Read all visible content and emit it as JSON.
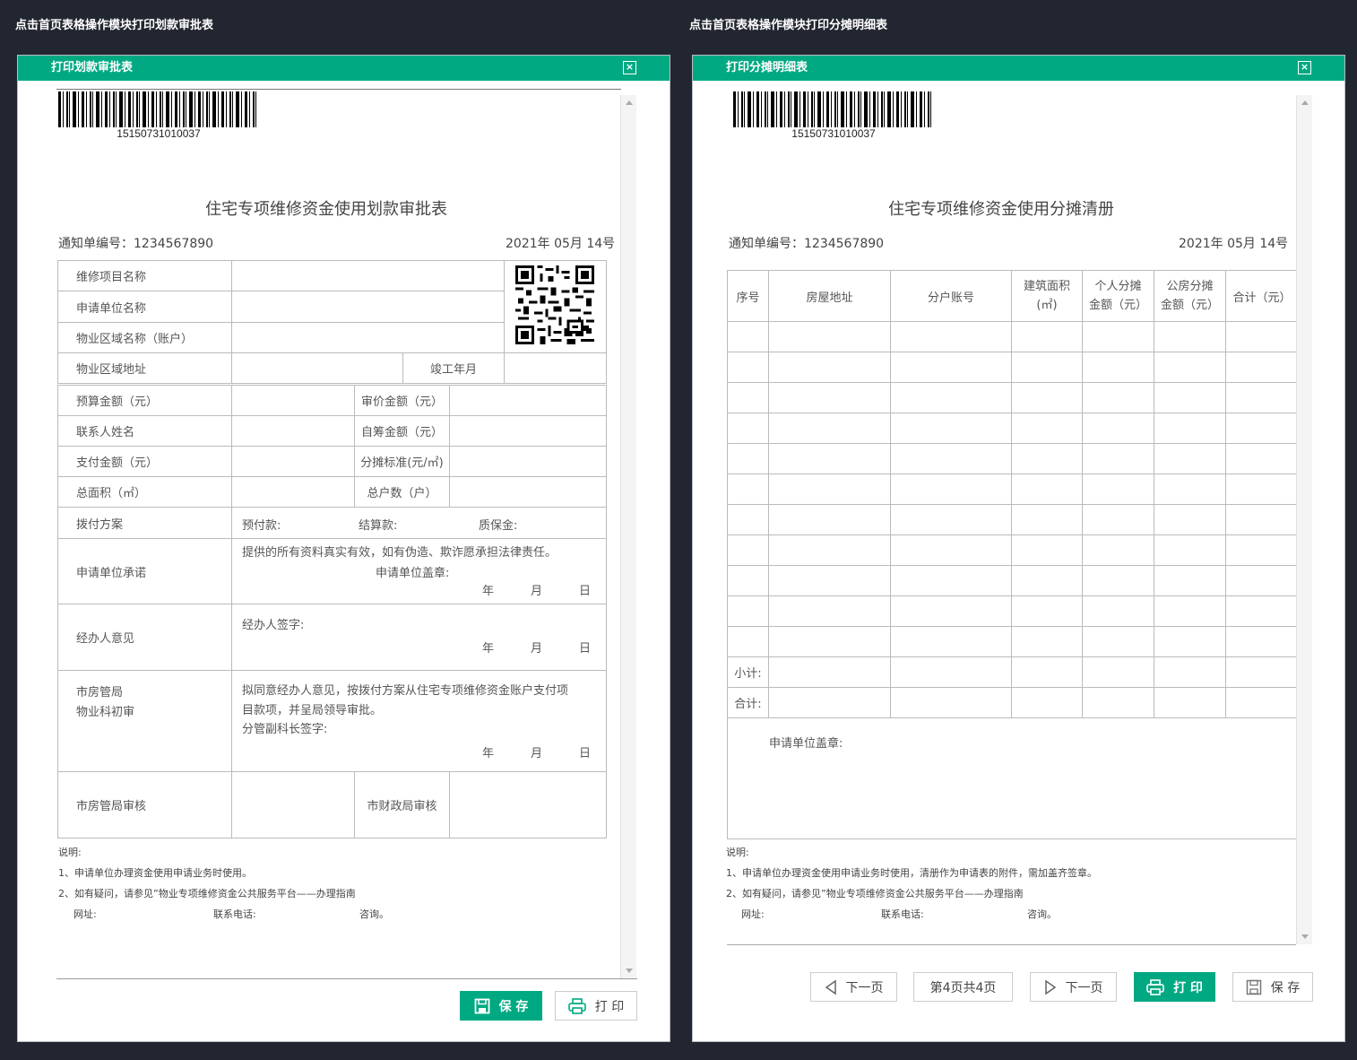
{
  "captions": {
    "left": "点击首页表格操作模块打印划款审批表",
    "right": "点击首页表格操作模块打印分摊明细表"
  },
  "left_dialog": {
    "title": "打印划款审批表",
    "barcode": "15150731010037",
    "form_title": "住宅专项维修资金使用划款审批表",
    "notice_no": "通知单编号：1234567890",
    "date": "2021年 05月 14号",
    "rows": {
      "project_name": "维修项目名称",
      "applicant_name": "申请单位名称",
      "area_name": "物业区域名称（账户）",
      "area_address": "物业区域地址",
      "completion": "竣工年月",
      "budget": "预算金额（元）",
      "audit_amount": "审价金额（元）",
      "contact": "联系人姓名",
      "self_raised": "自筹金额（元）",
      "pay_amount": "支付金额（元）",
      "share_std": "分摊标准(元/㎡)",
      "total_area": "总面积（㎡）",
      "households": "总户数（户）",
      "allocation": "拨付方案",
      "prepay": "预付款:",
      "settle": "结算款:",
      "warranty": "质保金:",
      "promise": "申请单位承诺",
      "promise_text": "提供的所有资料真实有效，如有伪造、欺诈愿承担法律责任。",
      "promise_seal": "申请单位盖章:",
      "handler_opinion": "经办人意见",
      "handler_sign": "经办人签字:",
      "bureau_l1": "市房管局",
      "bureau_l2": "物业科初审",
      "bureau_text1": "拟同意经办人意见，按拨付方案从住宅专项维修资金账户支付项",
      "bureau_text2": "目款项，并呈局领导审批。",
      "bureau_sign": "分管副科长签字:",
      "review": "市房管局审核",
      "finance_review": "市财政局审核",
      "year": "年",
      "month": "月",
      "day": "日"
    },
    "notes": [
      "说明:",
      "1、申请单位办理资金使用申请业务时使用。",
      "2、如有疑问，请参见”物业专项维修资金公共服务平台——办理指南",
      "网址:",
      "联系电话:",
      "咨询。"
    ],
    "buttons": {
      "save": "保 存",
      "print": "打 印"
    }
  },
  "right_dialog": {
    "title": "打印分摊明细表",
    "barcode": "15150731010037",
    "form_title": "住宅专项维修资金使用分摊清册",
    "notice_no": "通知单编号：1234567890",
    "date": "2021年 05月 14号",
    "columns": [
      "序号",
      "房屋地址",
      "分户账号",
      "建筑面积",
      "(㎡)",
      "个人分摊",
      "金额（元）",
      "公房分摊",
      "金额（元）",
      "合计（元）"
    ],
    "subtotal": "小计:",
    "total": "合计:",
    "seal": "申请单位盖章:",
    "notes": [
      "说明:",
      "1、申请单位办理资金使用申请业务时使用，清册作为申请表的附件，需加盖齐签章。",
      "2、如有疑问，请参见”物业专项维修资金公共服务平台——办理指南",
      "网址:",
      "联系电话:",
      "咨询。"
    ],
    "buttons": {
      "prev": "下一页",
      "page": "第4页共4页",
      "next": "下一页",
      "print": "打 印",
      "save": "保 存"
    }
  }
}
